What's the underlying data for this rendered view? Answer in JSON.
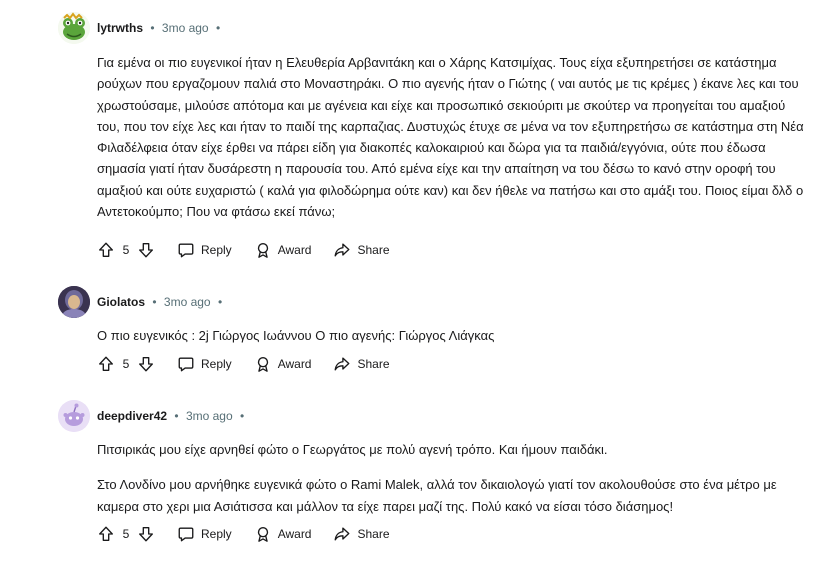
{
  "comments": [
    {
      "author": "lytrwths",
      "time": "3mo ago",
      "paragraphs": [
        "Για εμένα οι πιο ευγενικοί ήταν η Ελευθερία Αρβανιτάκη και ο Χάρης Κατσιμίχας. Τους είχα εξυπηρετήσει σε κατάστημα ρούχων που εργαζομουν παλιά στο Μοναστηράκι. Ο πιο αγενής ήταν ο Γιώτης ( ναι αυτός με τις κρέμες ) έκανε λες και του χρωστούσαμε, μιλούσε απότομα και με αγένεια και είχε και προσωπικό σεκιούριτι με σκούτερ να προηγείται του αμαξιού του, που τον είχε λες και ήταν το παιδί της καρπαζιας. Δυστυχώς έτυχε σε μένα να τον εξυπηρετήσω σε κατάστημα στη Νέα Φιλαδέλφεια όταν είχε έρθει να πάρει είδη για διακοπές καλοκαιριού και δώρα για τα παιδιά/εγγόνια, ούτε που έδωσα σημασία γιατί ήταν δυσάρεστη η παρουσία του. Από εμένα είχε και την απαίτηση να του δέσω το κανό στην οροφή του αμαξιού και ούτε ευχαριστώ ( καλά για φιλοδώρημα ούτε καν) και δεν ήθελε να πατήσω και στο αμάξι του. Ποιος είμαι δλδ ο Αντετοκούμπο; Που να φτάσω εκεί πάνω;"
      ],
      "score": "5",
      "reply": "Reply",
      "award": "Award",
      "share": "Share"
    },
    {
      "author": "Giolatos",
      "time": "3mo ago",
      "paragraphs": [
        "Ο πιο ευγενικός : 2j Γιώργος Ιωάννου Ο πιο αγενής: Γιώργος Λιάγκας"
      ],
      "score": "5",
      "reply": "Reply",
      "award": "Award",
      "share": "Share"
    },
    {
      "author": "deepdiver42",
      "time": "3mo ago",
      "paragraphs": [
        "Πιτσιρικάς μου είχε αρνηθεί φώτο ο Γεωργάτος με πολύ αγενή τρόπο. Και ήμουν παιδάκι.",
        "Στο Λονδίνο μου αρνήθηκε ευγενικά φώτο ο Rami Malek, αλλά τον δικαιολογώ γιατί τον ακολουθούσε στο ένα μέτρο με καμερα στο χερι μια Ασιάτισσα και μάλλον τα είχε παρει μαζί της. Πολύ κακό να είσαι τόσο διάσημος!"
      ],
      "score": "5",
      "reply": "Reply",
      "award": "Award",
      "share": "Share"
    }
  ],
  "separator": "•",
  "icons": {
    "upvote": "arrow-up-outline-icon",
    "downvote": "arrow-down-outline-icon",
    "reply": "speech-bubble-icon",
    "award": "award-ribbon-icon",
    "share": "share-arrow-icon"
  },
  "colors": {
    "text": "#1a1a1b",
    "meta": "#576f76",
    "avatar_green": "#5aa53b",
    "avatar_purple": "#c9b6e8"
  }
}
